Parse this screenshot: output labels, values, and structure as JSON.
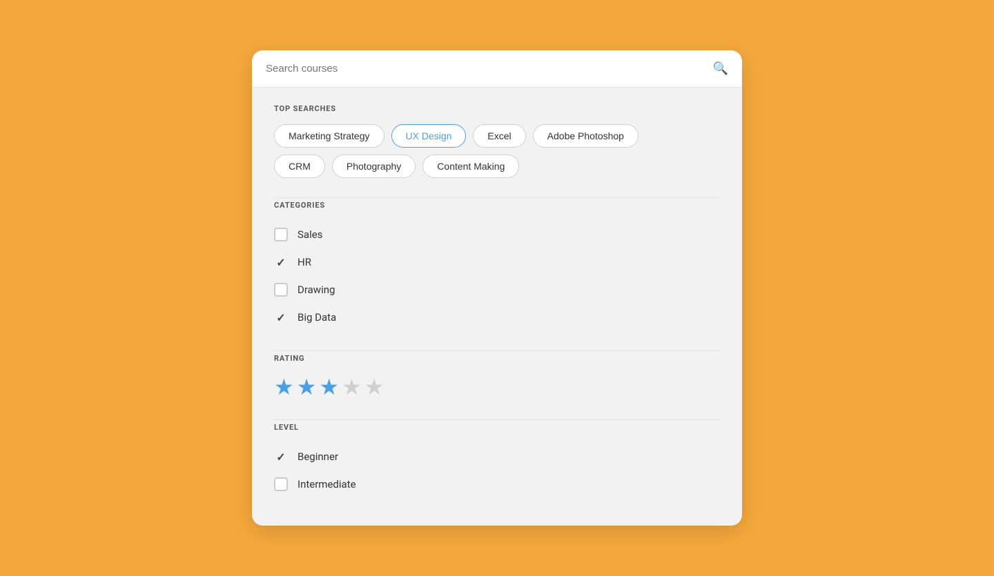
{
  "search": {
    "placeholder": "Search courses",
    "value": ""
  },
  "topSearches": {
    "title": "TOP SEARCHES",
    "tags": [
      {
        "label": "Marketing Strategy",
        "active": false
      },
      {
        "label": "UX Design",
        "active": true
      },
      {
        "label": "Excel",
        "active": false
      },
      {
        "label": "Adobe Photoshop",
        "active": false
      },
      {
        "label": "CRM",
        "active": false
      },
      {
        "label": "Photography",
        "active": false
      },
      {
        "label": "Content Making",
        "active": false
      }
    ]
  },
  "categories": {
    "title": "CATEGORIES",
    "items": [
      {
        "label": "Sales",
        "checked": false
      },
      {
        "label": "HR",
        "checked": true
      },
      {
        "label": "Drawing",
        "checked": false
      },
      {
        "label": "Big Data",
        "checked": true
      }
    ]
  },
  "rating": {
    "title": "RATING",
    "value": 3,
    "max": 5
  },
  "level": {
    "title": "LEVEL",
    "items": [
      {
        "label": "Beginner",
        "checked": true
      },
      {
        "label": "Intermediate",
        "checked": false
      }
    ]
  }
}
